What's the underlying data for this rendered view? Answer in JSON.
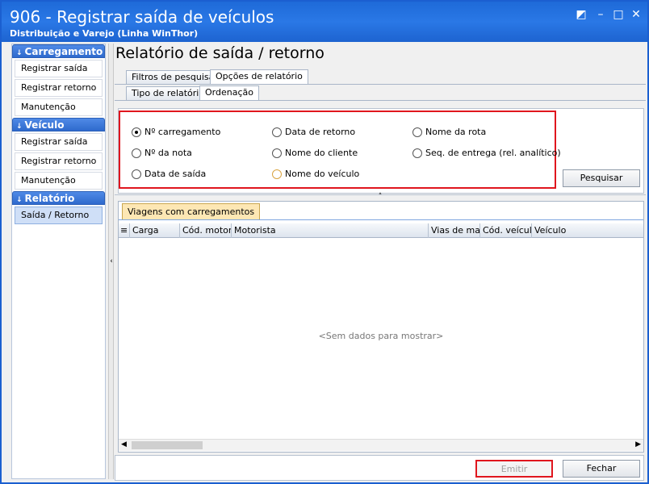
{
  "window": {
    "title": "906 - Registrar saída de veículos",
    "subtitle": "Distribuição e Varejo (Linha WinThor)",
    "controls": {
      "restore": "◩",
      "minimize": "–",
      "maximize": "□",
      "close": "✕"
    }
  },
  "sidebar": {
    "groups": [
      {
        "header": "Carregamento",
        "items": [
          "Registrar saída",
          "Registrar retorno",
          "Manutenção"
        ]
      },
      {
        "header": "Veículo",
        "items": [
          "Registrar saída",
          "Registrar retorno",
          "Manutenção"
        ]
      },
      {
        "header": "Relatório",
        "items": [
          "Saída / Retorno"
        ]
      }
    ],
    "chevron_icon": "double-chevron-down-icon"
  },
  "page": {
    "title": "Relatório de saída / retorno"
  },
  "tabs": {
    "row1": [
      "Filtros de pesquisa",
      "Opções de relatório"
    ],
    "row2": [
      "Tipo de relatório",
      "Ordenação"
    ]
  },
  "ordering": {
    "options": [
      {
        "label": "Nº carregamento",
        "selected": true
      },
      {
        "label": "Nº da nota",
        "selected": false
      },
      {
        "label": "Data de saída",
        "selected": false
      },
      {
        "label": "Data de retorno",
        "selected": false
      },
      {
        "label": "Nome do cliente",
        "selected": false
      },
      {
        "label": "Nome do veículo",
        "selected": false
      },
      {
        "label": "Nome da rota",
        "selected": false
      },
      {
        "label": "Seq. de entrega (rel. analítico)",
        "selected": false
      }
    ],
    "search_button": "Pesquisar",
    "highlight_color": "#e0161e"
  },
  "grid": {
    "tab_label": "Viagens com carregamentos",
    "columns": [
      "Carga",
      "Cód. motoris",
      "Motorista",
      "Vias de mapa",
      "Cód. veículo",
      "Veículo"
    ],
    "empty_text": "<Sem dados para mostrar>"
  },
  "footer": {
    "emit_button": "Emitir",
    "close_button": "Fechar"
  }
}
